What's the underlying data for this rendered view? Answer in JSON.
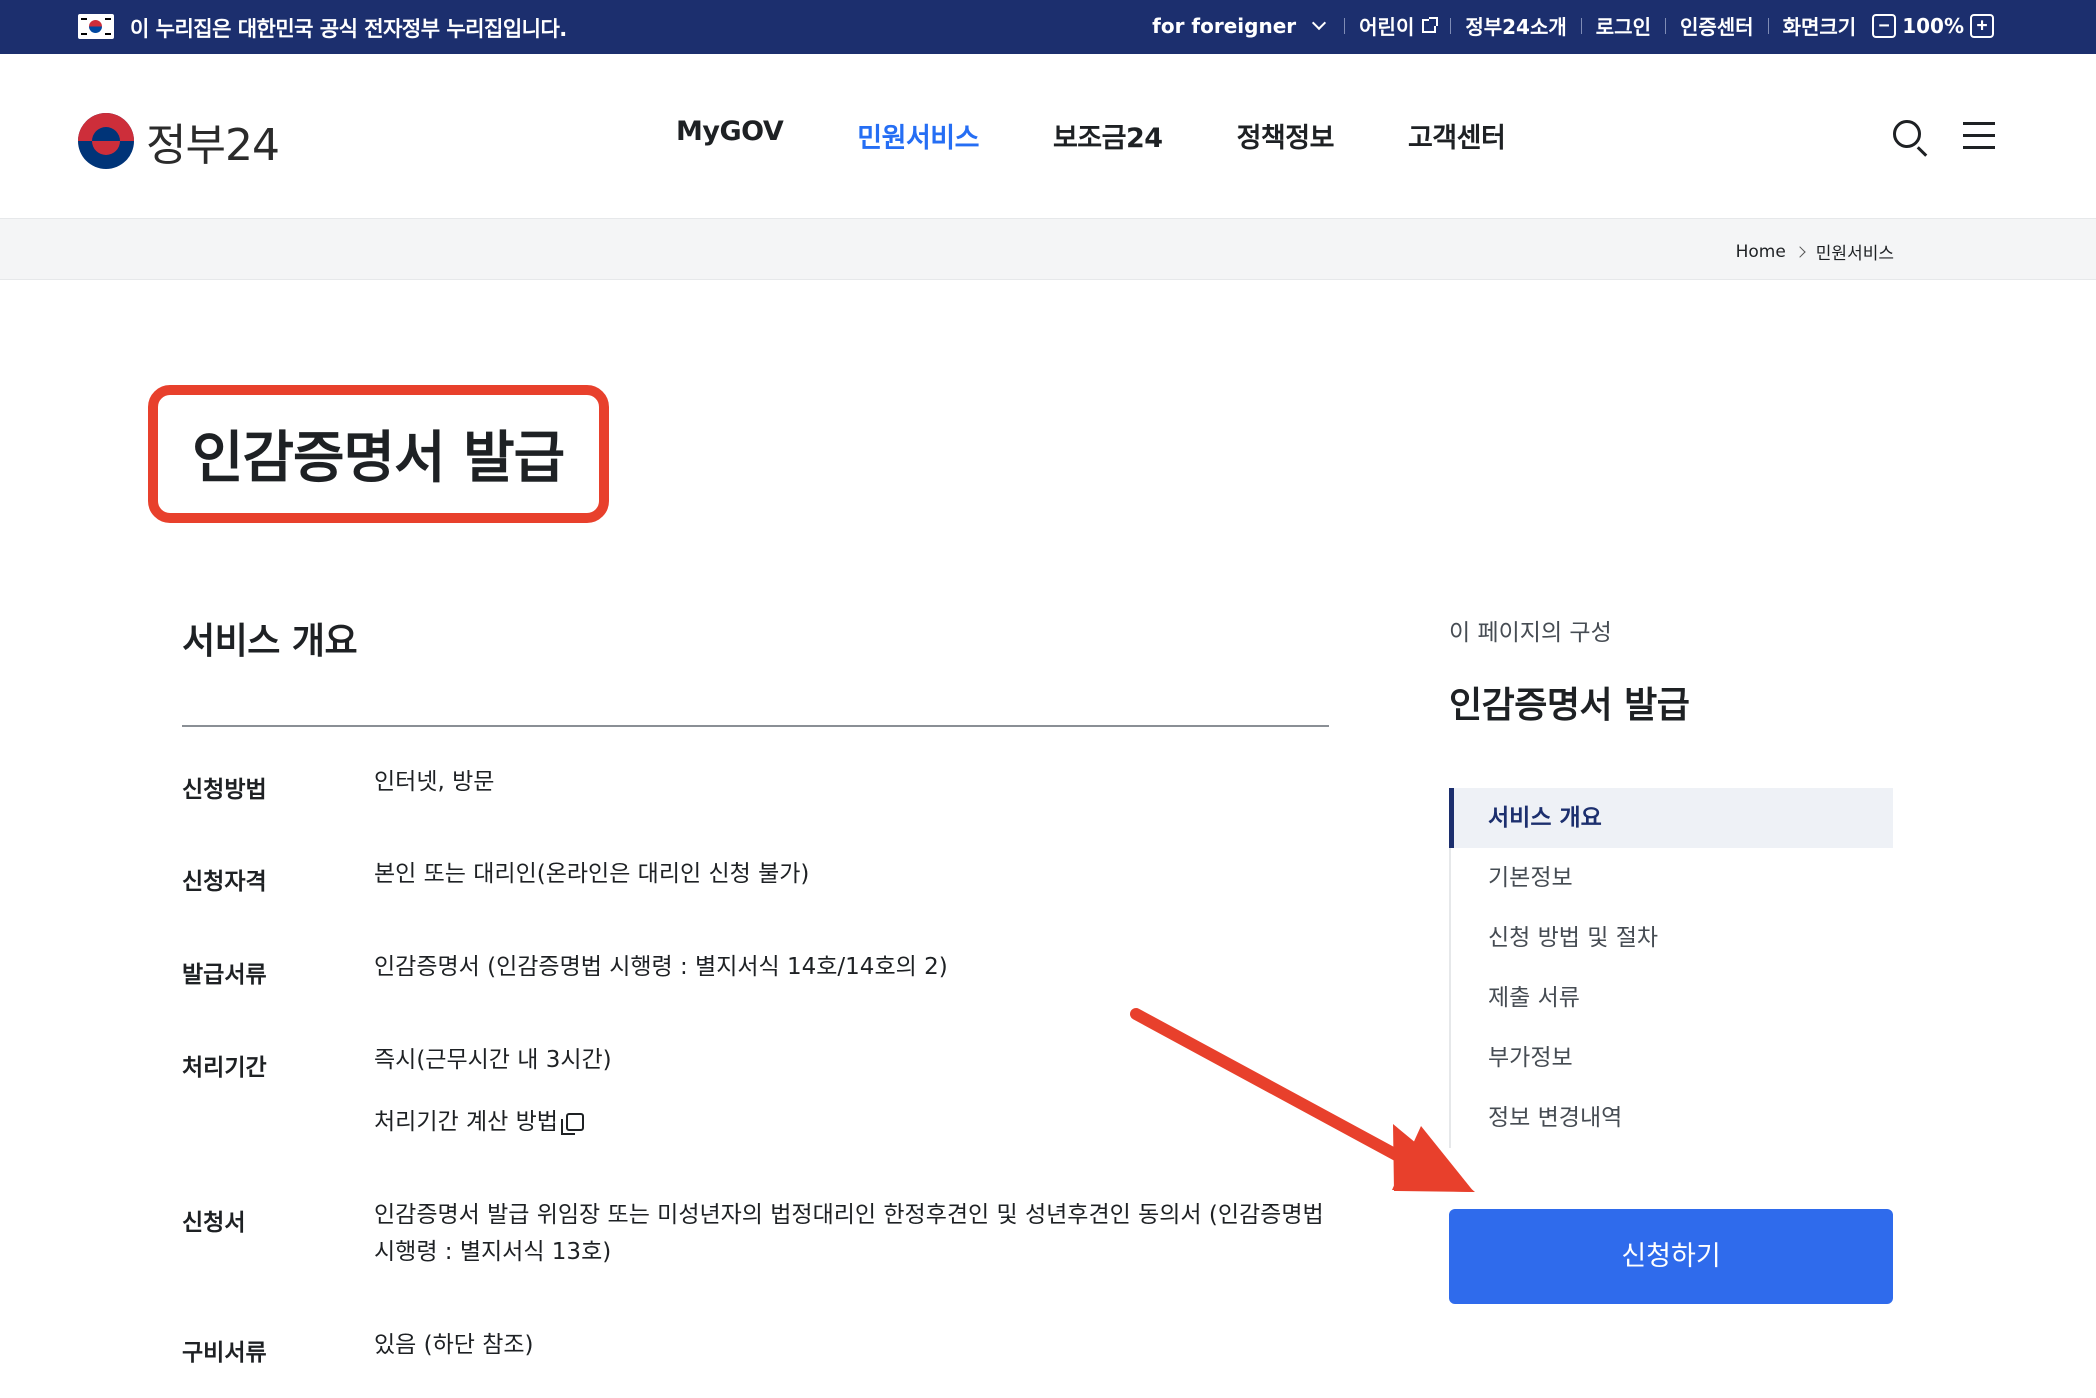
{
  "gov_bar": {
    "notice": "이 누리집은 대한민국 공식 전자정부 누리집입니다.",
    "utility": {
      "foreigner": "for foreigner",
      "kids": "어린이",
      "about": "정부24소개",
      "login": "로그인",
      "cert": "인증센터",
      "zoom_label": "화면크기",
      "zoom_minus": "−",
      "zoom_value": "100%",
      "zoom_plus": "+"
    }
  },
  "header": {
    "logo_text": "정부24",
    "nav": [
      "MyGOV",
      "민원서비스",
      "보조금24",
      "정책정보",
      "고객센터"
    ],
    "active_nav": "민원서비스"
  },
  "breadcrumb": [
    "Home",
    "민원서비스"
  ],
  "page_title": "인감증명서 발급",
  "section": {
    "title": "서비스 개요",
    "rows": [
      {
        "label": "신청방법",
        "value": "인터넷, 방문"
      },
      {
        "label": "신청자격",
        "value": "본인 또는 대리인(온라인은 대리인 신청 불가)"
      },
      {
        "label": "발급서류",
        "value": "인감증명서 (인감증명법 시행령 : 별지서식 14호/14호의 2)"
      },
      {
        "label": "처리기간",
        "value": "즉시(근무시간 내 3시간)",
        "sub": "처리기간 계산 방법"
      },
      {
        "label": "신청서",
        "value": "인감증명서 발급 위임장 또는 미성년자의 법정대리인 한정후견인 및 성년후견인 동의서 (인감증명법 시행령 : 별지서식 13호)"
      },
      {
        "label": "구비서류",
        "value": "있음 (하단 참조)"
      }
    ]
  },
  "toc": {
    "caption": "이 페이지의 구성",
    "heading": "인감증명서 발급",
    "items": [
      "서비스 개요",
      "기본정보",
      "신청 방법 및 절차",
      "제출 서류",
      "부가정보",
      "정보 변경내역"
    ],
    "active": "서비스 개요"
  },
  "apply_button": "신청하기",
  "colors": {
    "gov_bar_bg": "#1c2f6e",
    "accent_blue": "#256ef4",
    "button_blue": "#2f6bec",
    "annotation_red": "#e8402c"
  }
}
